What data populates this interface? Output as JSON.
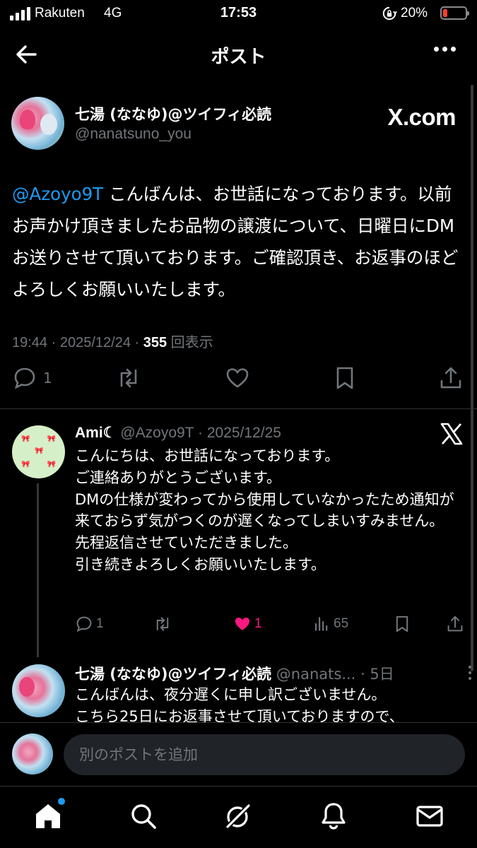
{
  "status_bar": {
    "carrier": "Rakuten",
    "network": "4G",
    "time": "17:53",
    "battery": "20%",
    "battery_level": 0.2
  },
  "header": {
    "title": "ポスト"
  },
  "post": {
    "author_name": "七湯 (ななゆ)@ツイフィ必読",
    "author_handle": "@nanatsuno_you",
    "source_logo": "X.com",
    "mention": "@Azoyo9T",
    "body": " こんばんは、お世話になっております。以前お声かけ頂きましたお品物の譲渡について、日曜日にDMお送りさせて頂いております。ご確認頂き、お返事のほどよろしくお願いいたします。",
    "time": "19:44",
    "date": "2025/12/24",
    "views": "355",
    "views_label": "回表示",
    "reply_count": "1"
  },
  "reply1": {
    "name": "Ami☾",
    "handle": "@Azoyo9T",
    "date": "2025/12/25",
    "body_lines": [
      "こんにちは、お世話になっております。",
      "ご連絡ありがとうございます。",
      "DMの仕様が変わってから使用していなかったため通知が来ておらず気がつくのが遅くなってしまいすみません。",
      "先程返信させていただきました。",
      "引き続きよろしくお願いいたします。"
    ],
    "replies": "1",
    "likes": "1",
    "views": "65"
  },
  "reply2": {
    "name": "七湯 (ななゆ)@ツイフィ必読",
    "handle": "@nanats...",
    "age": "5日",
    "body_line1": "こんばんは、夜分遅くに申し訳ございません。",
    "body_line2": "こちら25日にお返事させて頂いておりますので、"
  },
  "compose": {
    "placeholder": "別のポストを追加"
  },
  "tabs": [
    "home-icon",
    "search-icon",
    "grok-icon",
    "notifications-icon",
    "messages-icon"
  ],
  "colors": {
    "background": "#000000",
    "accent": "#1d9bf0",
    "like": "#f91880",
    "muted": "#71767b"
  }
}
